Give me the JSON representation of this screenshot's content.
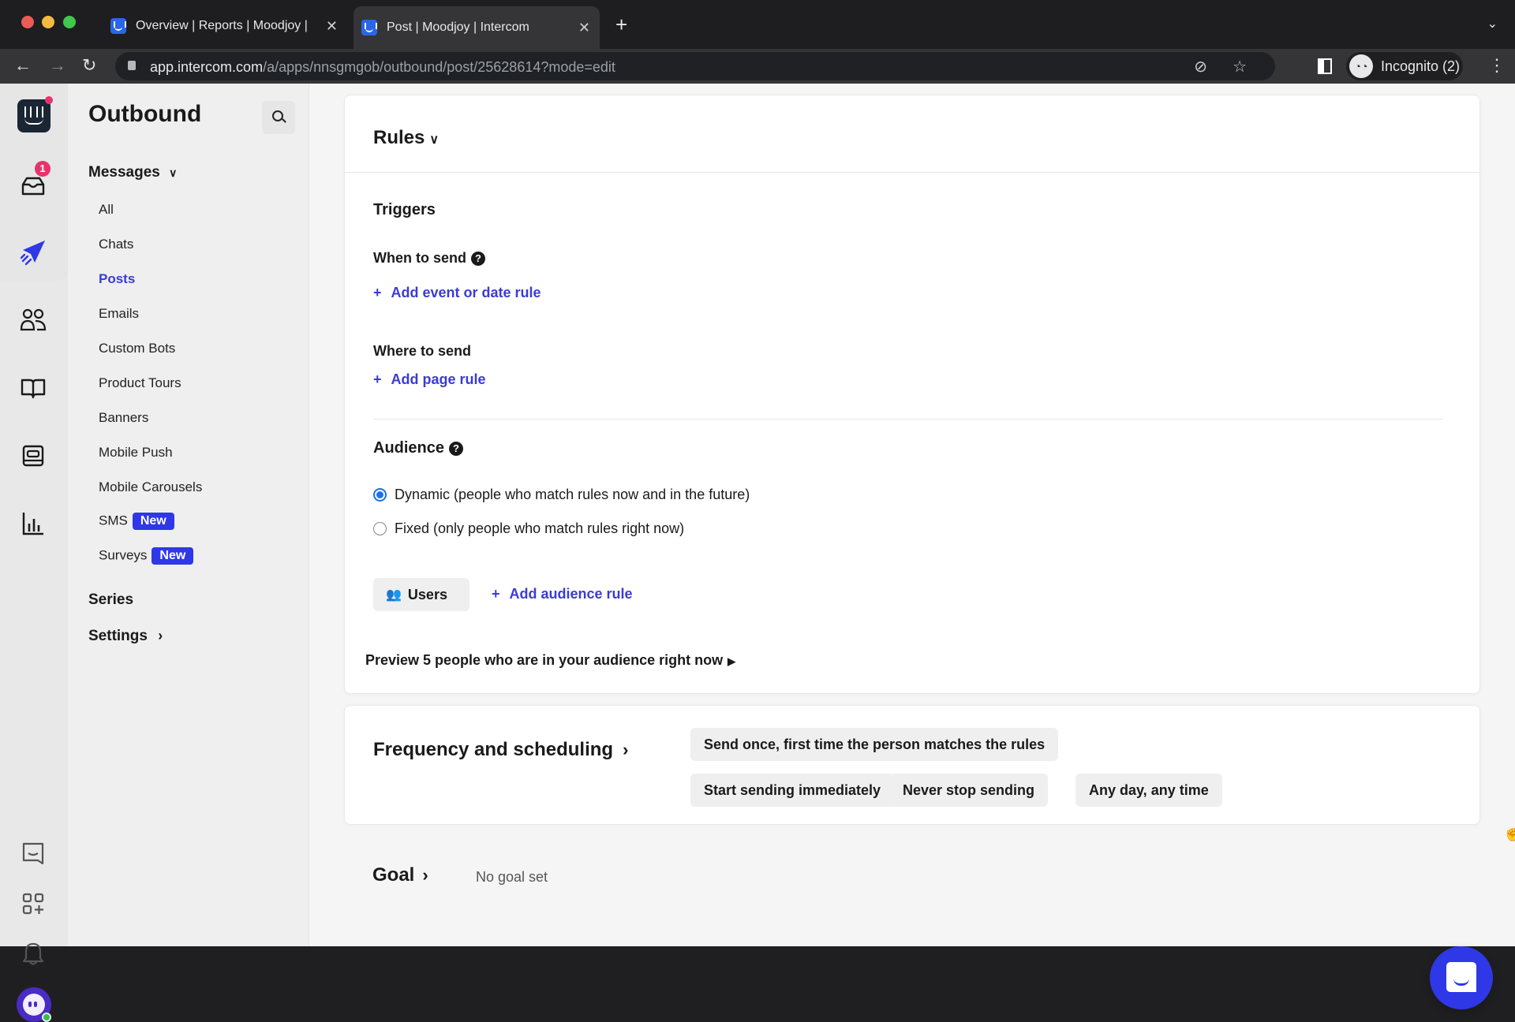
{
  "browser": {
    "tabs": [
      {
        "title": "Overview | Reports | Moodjoy |",
        "active": false
      },
      {
        "title": "Post | Moodjoy | Intercom",
        "active": true
      }
    ],
    "url_host": "app.intercom.com",
    "url_path": "/a/apps/nnsgmgob/outbound/post/25628614?mode=edit",
    "profile_label": "Incognito (2)"
  },
  "rail": {
    "inbox_badge": "1",
    "icons": [
      "intercom-logo",
      "inbox-icon",
      "outbound-icon",
      "contacts-icon",
      "articles-icon",
      "messenger-icon",
      "reports-icon",
      "chat-icon",
      "apps-icon",
      "notifications-icon",
      "avatar"
    ]
  },
  "subnav": {
    "title": "Outbound",
    "messages_label": "Messages",
    "items": [
      {
        "label": "All",
        "active": false
      },
      {
        "label": "Chats",
        "active": false
      },
      {
        "label": "Posts",
        "active": true
      },
      {
        "label": "Emails",
        "active": false
      },
      {
        "label": "Custom Bots",
        "active": false
      },
      {
        "label": "Product Tours",
        "active": false
      },
      {
        "label": "Banners",
        "active": false
      },
      {
        "label": "Mobile Push",
        "active": false
      },
      {
        "label": "Mobile Carousels",
        "active": false
      },
      {
        "label": "SMS",
        "active": false,
        "badge": "New"
      },
      {
        "label": "Surveys",
        "active": false,
        "badge": "New"
      }
    ],
    "series_label": "Series",
    "settings_label": "Settings"
  },
  "rules": {
    "title": "Rules",
    "triggers_title": "Triggers",
    "when_label": "When to send",
    "add_event_rule": "Add event or date rule",
    "where_label": "Where to send",
    "add_page_rule": "Add page rule",
    "audience_title": "Audience",
    "audience_options": [
      {
        "label": "Dynamic (people who match rules now and in the future)",
        "checked": true
      },
      {
        "label": "Fixed (only people who match rules right now)",
        "checked": false
      }
    ],
    "users_chip": "Users",
    "add_audience_rule": "Add audience rule",
    "preview": "Preview 5 people who are in your audience right now"
  },
  "frequency": {
    "title": "Frequency and scheduling",
    "chips": [
      "Send once, first time the person matches the rules",
      "Start sending immediately",
      "Never stop sending",
      "Any day, any time"
    ]
  },
  "goal": {
    "title": "Goal",
    "value": "No goal set"
  },
  "colors": {
    "accent": "#3b3bd6",
    "badge_blue": "#2e38e6",
    "badge_red": "#e8336a"
  }
}
